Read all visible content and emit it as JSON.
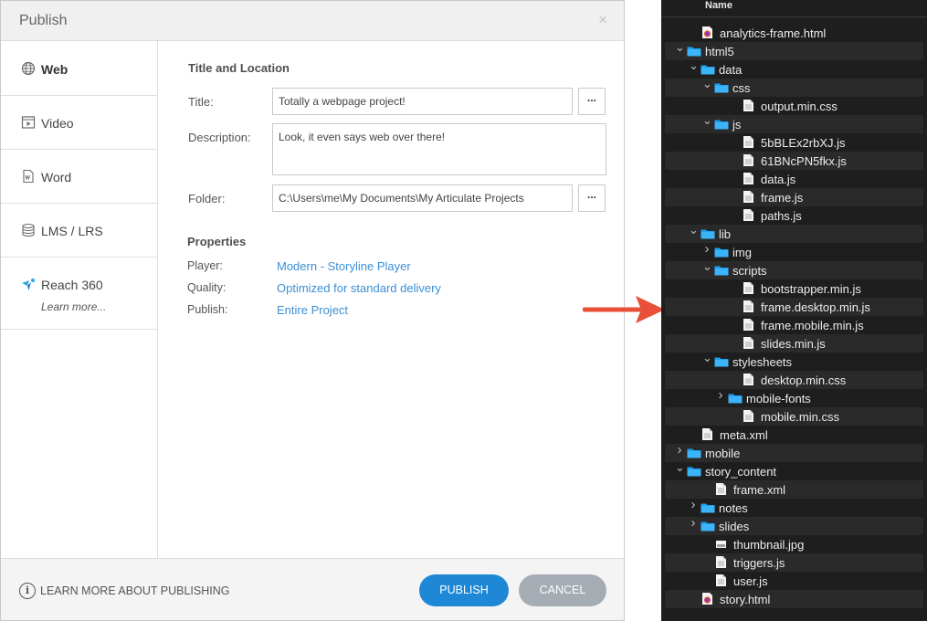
{
  "dialog": {
    "title": "Publish",
    "close_label": "×",
    "sidebar": [
      {
        "key": "web",
        "label": "Web",
        "icon": "globe-icon"
      },
      {
        "key": "video",
        "label": "Video",
        "icon": "video-icon"
      },
      {
        "key": "word",
        "label": "Word",
        "icon": "word-document-icon"
      },
      {
        "key": "lms",
        "label": "LMS / LRS",
        "icon": "database-icon"
      },
      {
        "key": "reach",
        "label": "Reach 360",
        "icon": "reach-360-icon",
        "sublabel": "Learn more..."
      }
    ],
    "title_location": {
      "heading": "Title and Location",
      "title_label": "Title:",
      "title_value": "Totally a webpage project!",
      "description_label": "Description:",
      "description_value": "Look, it even says web over there!",
      "folder_label": "Folder:",
      "folder_value": "C:\\Users\\me\\My Documents\\My Articulate Projects",
      "browse_label": "..."
    },
    "properties": {
      "heading": "Properties",
      "player_label": "Player:",
      "player_value": "Modern - Storyline Player",
      "quality_label": "Quality:",
      "quality_value": "Optimized for standard delivery",
      "publish_label": "Publish:",
      "publish_value": "Entire Project"
    },
    "footer": {
      "learn_more": "LEARN MORE ABOUT PUBLISHING",
      "info_icon_glyph": "i",
      "publish_button": "PUBLISH",
      "cancel_button": "CANCEL"
    },
    "colors": {
      "accent": "#1e88d6",
      "link": "#3a8fd6",
      "cancel": "#a5acb3",
      "arrow": "#e8503a"
    }
  },
  "file_tree": {
    "header": "Name",
    "rows": [
      {
        "name": "analytics-frame.html",
        "type": "html",
        "depth": 1,
        "expanded": null
      },
      {
        "name": "html5",
        "type": "folder",
        "depth": 0,
        "expanded": true
      },
      {
        "name": "data",
        "type": "folder",
        "depth": 1,
        "expanded": true
      },
      {
        "name": "css",
        "type": "folder",
        "depth": 2,
        "expanded": true
      },
      {
        "name": "output.min.css",
        "type": "file",
        "depth": 4,
        "expanded": null
      },
      {
        "name": "js",
        "type": "folder",
        "depth": 2,
        "expanded": true
      },
      {
        "name": "5bBLEx2rbXJ.js",
        "type": "file",
        "depth": 4,
        "expanded": null
      },
      {
        "name": "61BNcPN5fkx.js",
        "type": "file",
        "depth": 4,
        "expanded": null
      },
      {
        "name": "data.js",
        "type": "file",
        "depth": 4,
        "expanded": null
      },
      {
        "name": "frame.js",
        "type": "file",
        "depth": 4,
        "expanded": null
      },
      {
        "name": "paths.js",
        "type": "file",
        "depth": 4,
        "expanded": null
      },
      {
        "name": "lib",
        "type": "folder",
        "depth": 1,
        "expanded": true
      },
      {
        "name": "img",
        "type": "folder",
        "depth": 2,
        "expanded": false
      },
      {
        "name": "scripts",
        "type": "folder",
        "depth": 2,
        "expanded": true
      },
      {
        "name": "bootstrapper.min.js",
        "type": "file",
        "depth": 4,
        "expanded": null
      },
      {
        "name": "frame.desktop.min.js",
        "type": "file",
        "depth": 4,
        "expanded": null
      },
      {
        "name": "frame.mobile.min.js",
        "type": "file",
        "depth": 4,
        "expanded": null
      },
      {
        "name": "slides.min.js",
        "type": "file",
        "depth": 4,
        "expanded": null
      },
      {
        "name": "stylesheets",
        "type": "folder",
        "depth": 2,
        "expanded": true
      },
      {
        "name": "desktop.min.css",
        "type": "file",
        "depth": 4,
        "expanded": null
      },
      {
        "name": "mobile-fonts",
        "type": "folder",
        "depth": 3,
        "expanded": false
      },
      {
        "name": "mobile.min.css",
        "type": "file",
        "depth": 4,
        "expanded": null
      },
      {
        "name": "meta.xml",
        "type": "file",
        "depth": 1,
        "expanded": null
      },
      {
        "name": "mobile",
        "type": "folder",
        "depth": 0,
        "expanded": false
      },
      {
        "name": "story_content",
        "type": "folder",
        "depth": 0,
        "expanded": true
      },
      {
        "name": "frame.xml",
        "type": "file",
        "depth": 2,
        "expanded": null
      },
      {
        "name": "notes",
        "type": "folder",
        "depth": 1,
        "expanded": false
      },
      {
        "name": "slides",
        "type": "folder",
        "depth": 1,
        "expanded": false
      },
      {
        "name": "thumbnail.jpg",
        "type": "image",
        "depth": 2,
        "expanded": null
      },
      {
        "name": "triggers.js",
        "type": "file",
        "depth": 2,
        "expanded": null
      },
      {
        "name": "user.js",
        "type": "file",
        "depth": 2,
        "expanded": null
      },
      {
        "name": "story.html",
        "type": "html",
        "depth": 1,
        "expanded": null
      }
    ]
  }
}
